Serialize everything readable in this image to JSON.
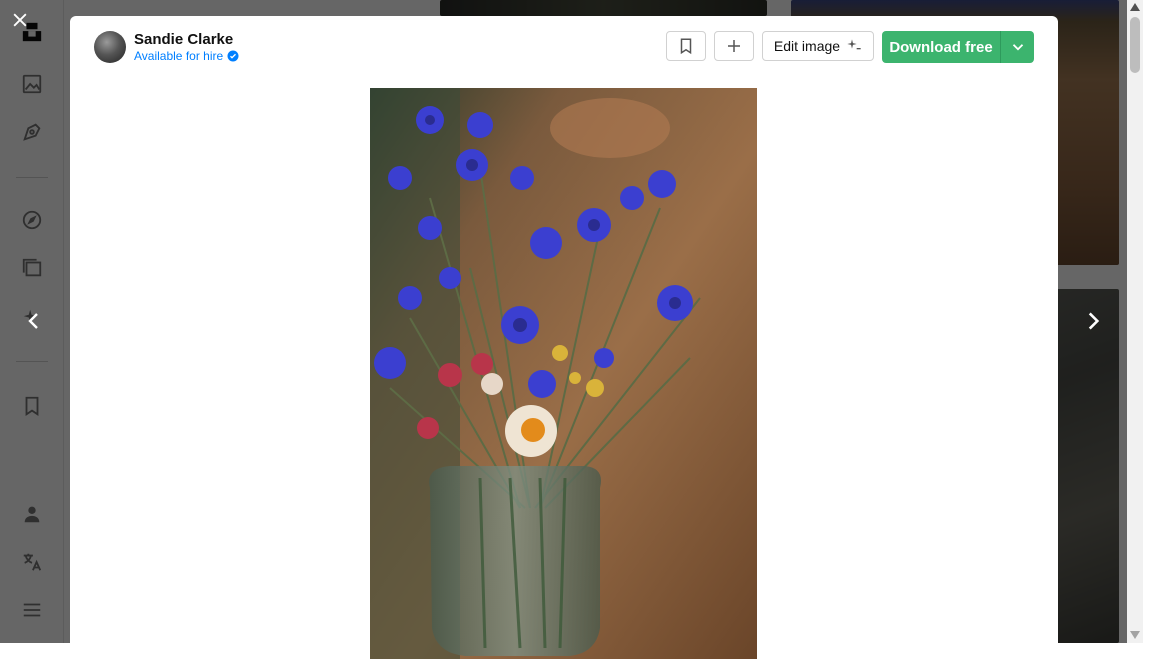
{
  "author": {
    "name": "Sandie Clarke",
    "status": "Available for hire"
  },
  "toolbar": {
    "edit_label": "Edit image",
    "download_label": "Download free"
  },
  "colors": {
    "brand_green": "#3cb46e",
    "link_blue": "#007fff",
    "overlay": "rgba(0,0,0,0.6)"
  },
  "icons": {
    "sidebar": [
      "unsplash-logo-icon",
      "image-icon",
      "pen-icon",
      "compass-icon",
      "collections-icon",
      "sparkle-edit-icon",
      "bookmark-icon",
      "user-icon",
      "translate-icon",
      "menu-icon"
    ],
    "modal": [
      "close-icon",
      "chevron-left-icon",
      "chevron-right-icon",
      "bookmark-icon",
      "plus-icon",
      "sparkle-icon",
      "chevron-down-icon",
      "verified-badge-icon"
    ]
  },
  "photo": {
    "description_alt": "Bouquet of blue cornflowers and dried flowers in a glass jar on a wooden table"
  }
}
